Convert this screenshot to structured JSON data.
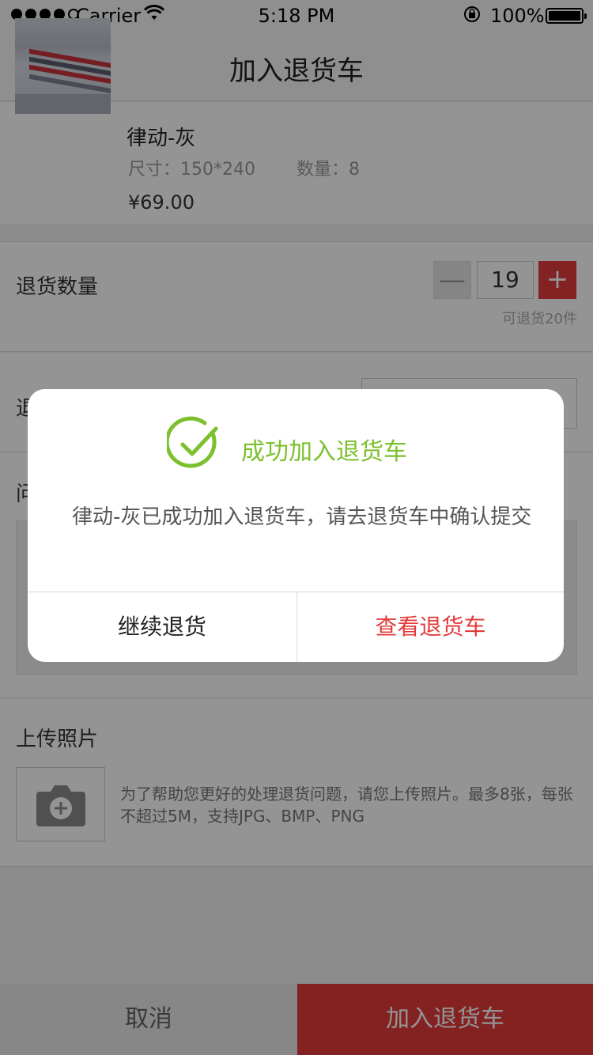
{
  "status_bar": {
    "carrier": "Carrier",
    "time": "5:18 PM",
    "battery": "100%"
  },
  "nav": {
    "title": "加入退货车"
  },
  "product": {
    "name": "律动-灰",
    "size": "尺寸：150*240",
    "quantity": "数量：8",
    "price": "¥69.00"
  },
  "return_qty": {
    "label": "退货数量",
    "value": "19",
    "minus": "—",
    "plus": "+",
    "hint": "可退货20件"
  },
  "return_reason": {
    "label_visible": "退"
  },
  "problem": {
    "label_visible": "问"
  },
  "upload": {
    "label": "上传照片",
    "hint": "为了帮助您更好的处理退货问题，请您上传照片。最多8张，每张不超过5M，支持JPG、BMP、PNG"
  },
  "bottom": {
    "cancel": "取消",
    "add": "加入退货车"
  },
  "dialog": {
    "title": "成功加入退货车",
    "message": "律动-灰已成功加入退货车，请去退货车中确认提交",
    "continue": "继续退货",
    "view_cart": "查看退货车"
  },
  "colors": {
    "accent_red": "#e33b3b",
    "success_green": "#7cc02e"
  }
}
